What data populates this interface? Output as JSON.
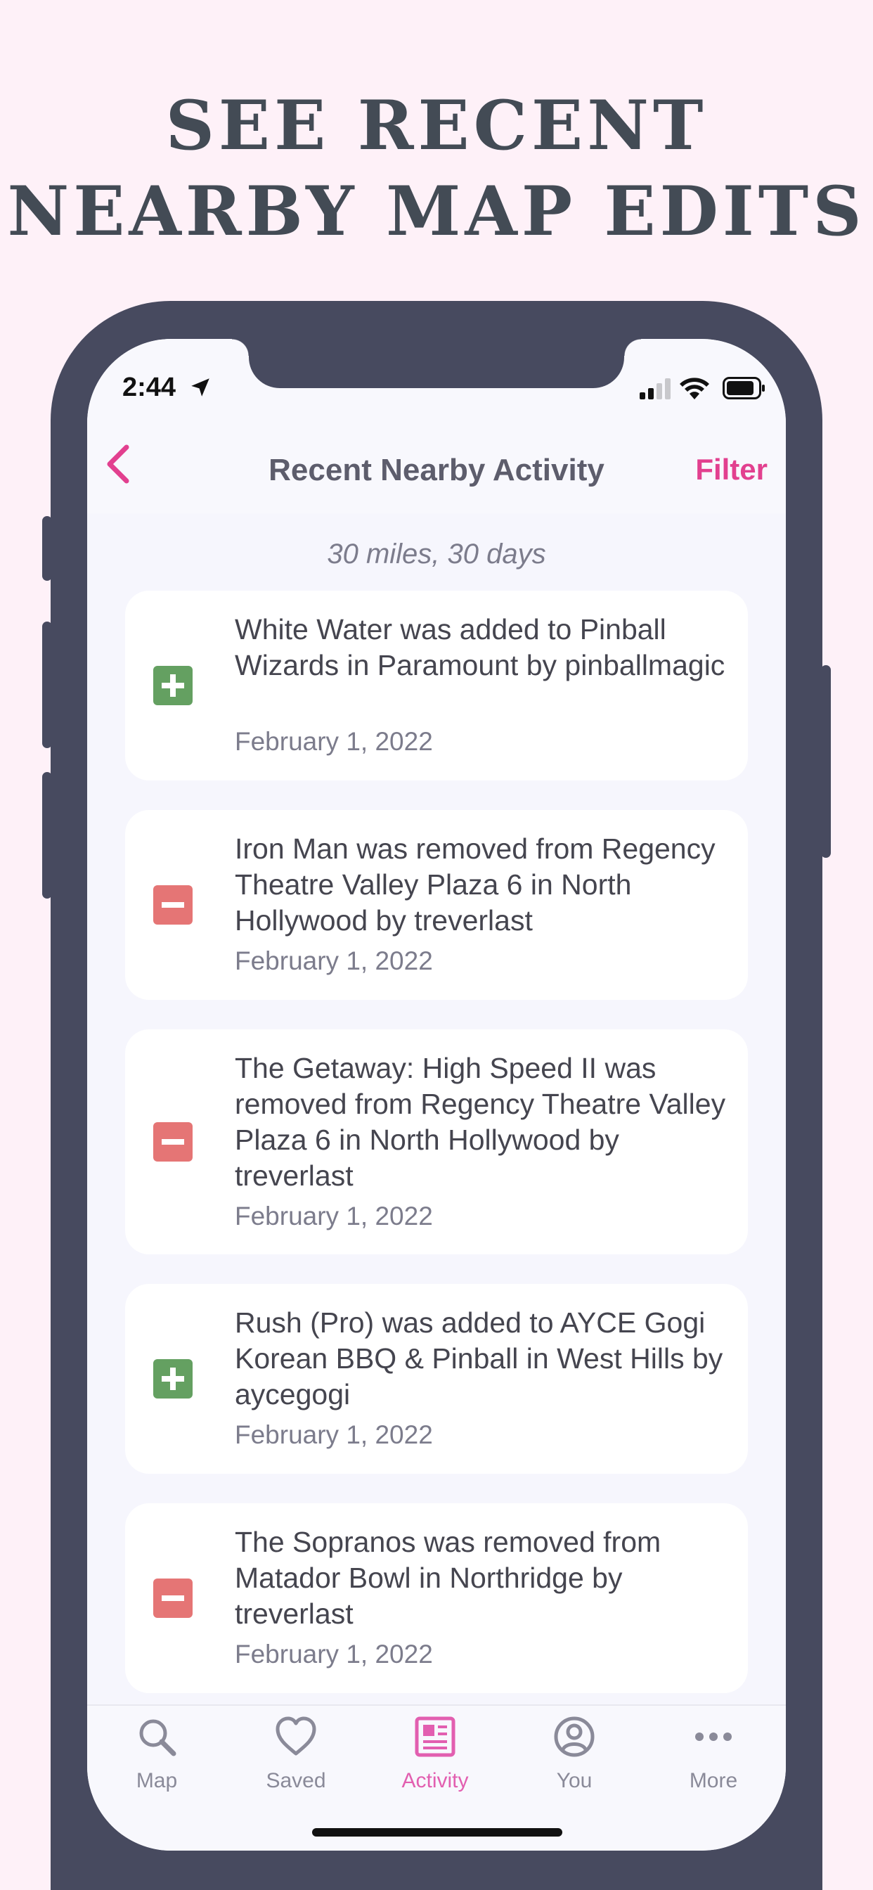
{
  "headline": {
    "line1": "SEE RECENT",
    "line2": "NEARBY MAP EDITS"
  },
  "status_bar": {
    "time": "2:44",
    "icons": [
      "location-arrow-icon",
      "cellular-signal-icon",
      "wifi-icon",
      "battery-icon"
    ]
  },
  "nav": {
    "back_icon": "chevron-left-icon",
    "title": "Recent Nearby Activity",
    "filter_label": "Filter"
  },
  "subheading": "30 miles, 30 days",
  "activity": [
    {
      "type": "added",
      "icon": "plus-icon",
      "text": "White Water was added to Pinball Wizards in Paramount by pinballmagic",
      "date": "February 1, 2022"
    },
    {
      "type": "removed",
      "icon": "minus-icon",
      "text": "Iron Man was removed from Regency Theatre Valley Plaza 6 in North Hollywood by treverlast",
      "date": "February 1, 2022"
    },
    {
      "type": "removed",
      "icon": "minus-icon",
      "text": "The Getaway: High Speed II was removed from Regency Theatre Valley Plaza 6 in North Hollywood by treverlast",
      "date": "February 1, 2022"
    },
    {
      "type": "added",
      "icon": "plus-icon",
      "text": "Rush (Pro) was added to AYCE Gogi Korean BBQ & Pinball in West Hills by aycegogi",
      "date": "February 1, 2022"
    },
    {
      "type": "removed",
      "icon": "minus-icon",
      "text": "The Sopranos was removed from Matador Bowl in Northridge by treverlast",
      "date": "February 1, 2022"
    }
  ],
  "tabs": [
    {
      "label": "Map",
      "icon": "search-icon",
      "active": false
    },
    {
      "label": "Saved",
      "icon": "heart-icon",
      "active": false
    },
    {
      "label": "Activity",
      "icon": "newspaper-icon",
      "active": true
    },
    {
      "label": "You",
      "icon": "user-circle-icon",
      "active": false
    },
    {
      "label": "More",
      "icon": "ellipsis-icon",
      "active": false
    }
  ],
  "colors": {
    "accent": "#e2408f",
    "active_tab": "#e25fb0",
    "added": "#64a061",
    "removed": "#e57575",
    "phone_frame": "#474a5f",
    "page_background": "#fef1f8"
  }
}
